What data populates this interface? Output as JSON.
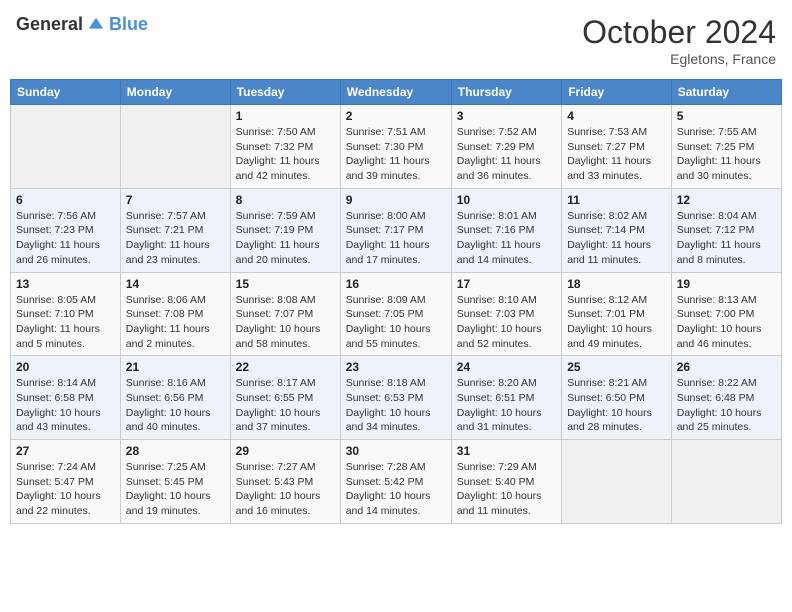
{
  "logo": {
    "general": "General",
    "blue": "Blue"
  },
  "header": {
    "month": "October 2024",
    "location": "Egletons, France"
  },
  "weekdays": [
    "Sunday",
    "Monday",
    "Tuesday",
    "Wednesday",
    "Thursday",
    "Friday",
    "Saturday"
  ],
  "weeks": [
    [
      null,
      null,
      {
        "day": "1",
        "sunrise": "7:50 AM",
        "sunset": "7:32 PM",
        "daylight": "11 hours and 42 minutes."
      },
      {
        "day": "2",
        "sunrise": "7:51 AM",
        "sunset": "7:30 PM",
        "daylight": "11 hours and 39 minutes."
      },
      {
        "day": "3",
        "sunrise": "7:52 AM",
        "sunset": "7:29 PM",
        "daylight": "11 hours and 36 minutes."
      },
      {
        "day": "4",
        "sunrise": "7:53 AM",
        "sunset": "7:27 PM",
        "daylight": "11 hours and 33 minutes."
      },
      {
        "day": "5",
        "sunrise": "7:55 AM",
        "sunset": "7:25 PM",
        "daylight": "11 hours and 30 minutes."
      }
    ],
    [
      {
        "day": "6",
        "sunrise": "7:56 AM",
        "sunset": "7:23 PM",
        "daylight": "11 hours and 26 minutes."
      },
      {
        "day": "7",
        "sunrise": "7:57 AM",
        "sunset": "7:21 PM",
        "daylight": "11 hours and 23 minutes."
      },
      {
        "day": "8",
        "sunrise": "7:59 AM",
        "sunset": "7:19 PM",
        "daylight": "11 hours and 20 minutes."
      },
      {
        "day": "9",
        "sunrise": "8:00 AM",
        "sunset": "7:17 PM",
        "daylight": "11 hours and 17 minutes."
      },
      {
        "day": "10",
        "sunrise": "8:01 AM",
        "sunset": "7:16 PM",
        "daylight": "11 hours and 14 minutes."
      },
      {
        "day": "11",
        "sunrise": "8:02 AM",
        "sunset": "7:14 PM",
        "daylight": "11 hours and 11 minutes."
      },
      {
        "day": "12",
        "sunrise": "8:04 AM",
        "sunset": "7:12 PM",
        "daylight": "11 hours and 8 minutes."
      }
    ],
    [
      {
        "day": "13",
        "sunrise": "8:05 AM",
        "sunset": "7:10 PM",
        "daylight": "11 hours and 5 minutes."
      },
      {
        "day": "14",
        "sunrise": "8:06 AM",
        "sunset": "7:08 PM",
        "daylight": "11 hours and 2 minutes."
      },
      {
        "day": "15",
        "sunrise": "8:08 AM",
        "sunset": "7:07 PM",
        "daylight": "10 hours and 58 minutes."
      },
      {
        "day": "16",
        "sunrise": "8:09 AM",
        "sunset": "7:05 PM",
        "daylight": "10 hours and 55 minutes."
      },
      {
        "day": "17",
        "sunrise": "8:10 AM",
        "sunset": "7:03 PM",
        "daylight": "10 hours and 52 minutes."
      },
      {
        "day": "18",
        "sunrise": "8:12 AM",
        "sunset": "7:01 PM",
        "daylight": "10 hours and 49 minutes."
      },
      {
        "day": "19",
        "sunrise": "8:13 AM",
        "sunset": "7:00 PM",
        "daylight": "10 hours and 46 minutes."
      }
    ],
    [
      {
        "day": "20",
        "sunrise": "8:14 AM",
        "sunset": "6:58 PM",
        "daylight": "10 hours and 43 minutes."
      },
      {
        "day": "21",
        "sunrise": "8:16 AM",
        "sunset": "6:56 PM",
        "daylight": "10 hours and 40 minutes."
      },
      {
        "day": "22",
        "sunrise": "8:17 AM",
        "sunset": "6:55 PM",
        "daylight": "10 hours and 37 minutes."
      },
      {
        "day": "23",
        "sunrise": "8:18 AM",
        "sunset": "6:53 PM",
        "daylight": "10 hours and 34 minutes."
      },
      {
        "day": "24",
        "sunrise": "8:20 AM",
        "sunset": "6:51 PM",
        "daylight": "10 hours and 31 minutes."
      },
      {
        "day": "25",
        "sunrise": "8:21 AM",
        "sunset": "6:50 PM",
        "daylight": "10 hours and 28 minutes."
      },
      {
        "day": "26",
        "sunrise": "8:22 AM",
        "sunset": "6:48 PM",
        "daylight": "10 hours and 25 minutes."
      }
    ],
    [
      {
        "day": "27",
        "sunrise": "7:24 AM",
        "sunset": "5:47 PM",
        "daylight": "10 hours and 22 minutes."
      },
      {
        "day": "28",
        "sunrise": "7:25 AM",
        "sunset": "5:45 PM",
        "daylight": "10 hours and 19 minutes."
      },
      {
        "day": "29",
        "sunrise": "7:27 AM",
        "sunset": "5:43 PM",
        "daylight": "10 hours and 16 minutes."
      },
      {
        "day": "30",
        "sunrise": "7:28 AM",
        "sunset": "5:42 PM",
        "daylight": "10 hours and 14 minutes."
      },
      {
        "day": "31",
        "sunrise": "7:29 AM",
        "sunset": "5:40 PM",
        "daylight": "10 hours and 11 minutes."
      },
      null,
      null
    ]
  ],
  "labels": {
    "sunrise": "Sunrise:",
    "sunset": "Sunset:",
    "daylight": "Daylight:"
  }
}
